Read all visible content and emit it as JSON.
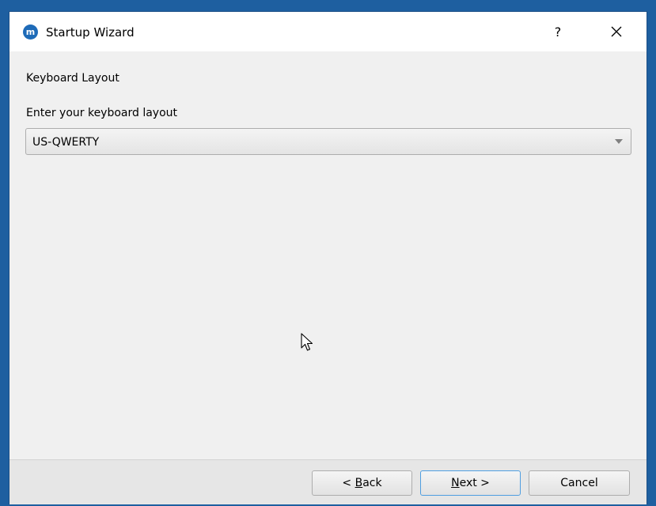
{
  "window": {
    "title": "Startup Wizard",
    "app_icon_text": "m",
    "help_label": "?"
  },
  "page": {
    "heading": "Keyboard Layout",
    "field_label": "Enter your keyboard layout",
    "layout_select": {
      "selected": "US-QWERTY"
    }
  },
  "footer": {
    "back_prefix": "< ",
    "back_mnemonic": "B",
    "back_rest": "ack",
    "next_mnemonic": "N",
    "next_rest": "ext >",
    "cancel_label": "Cancel"
  },
  "colors": {
    "accent": "#1e6bb8",
    "desktop": "#1e5fa0",
    "focus_border": "#4f9ee0"
  }
}
